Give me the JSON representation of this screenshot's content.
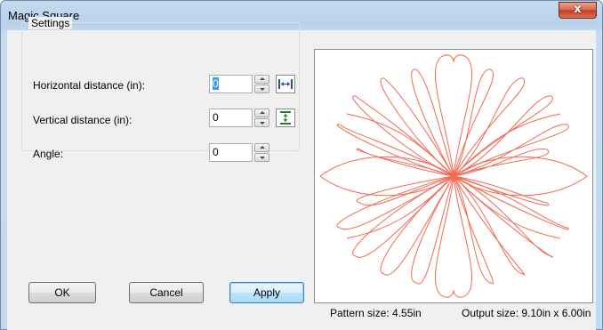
{
  "window": {
    "title": "Magic Square",
    "close_glyph": "x"
  },
  "settings": {
    "group_title": "Settings",
    "horizontal": {
      "label": "Horizontal distance (in):",
      "value": "0",
      "icon": "horizontal-spacing-icon"
    },
    "vertical": {
      "label": "Vertical distance (in):",
      "value": "0",
      "icon": "vertical-spacing-icon"
    },
    "angle": {
      "label": "Angle:",
      "value": "0"
    }
  },
  "buttons": {
    "ok": "OK",
    "cancel": "Cancel",
    "apply": "Apply"
  },
  "status": {
    "pattern_size": "Pattern size: 4.55in",
    "output_size": "Output size: 9.10in x 6.00in"
  },
  "colors": {
    "pattern_stroke": "#f26a55",
    "titlebar": "#b9d1ea",
    "dialog_bg": "#f0f0f0",
    "close_button": "#c2391c"
  }
}
